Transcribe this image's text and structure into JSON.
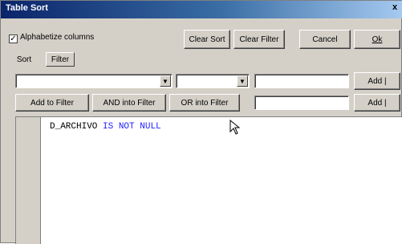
{
  "window": {
    "title": "Table Sort",
    "close_label": "x"
  },
  "options": {
    "alphabetize_label": "Alphabetize columns",
    "alphabetize_checked": true
  },
  "buttons": {
    "clear_sort": "Clear Sort",
    "clear_filter": "Clear Filter",
    "cancel": "Cancel",
    "ok": "Ok",
    "add_to_filter": "Add to Filter",
    "and_into_filter": "AND into Filter",
    "or_into_filter": "OR into Filter",
    "add_1": "Add |",
    "add_2": "Add |"
  },
  "tabs": [
    {
      "label": "Sort",
      "selected": false
    },
    {
      "label": "Filter",
      "selected": true
    }
  ],
  "filter_row": {
    "column_value": "",
    "operator_value": "",
    "value_text": "",
    "second_value_text": ""
  },
  "editor": {
    "column": "D_ARCHIVO",
    "condition": "IS NOT NULL"
  },
  "colors": {
    "keyword": "#2020ff",
    "titlebar_start": "#0a246a",
    "titlebar_end": "#a6caf0"
  }
}
